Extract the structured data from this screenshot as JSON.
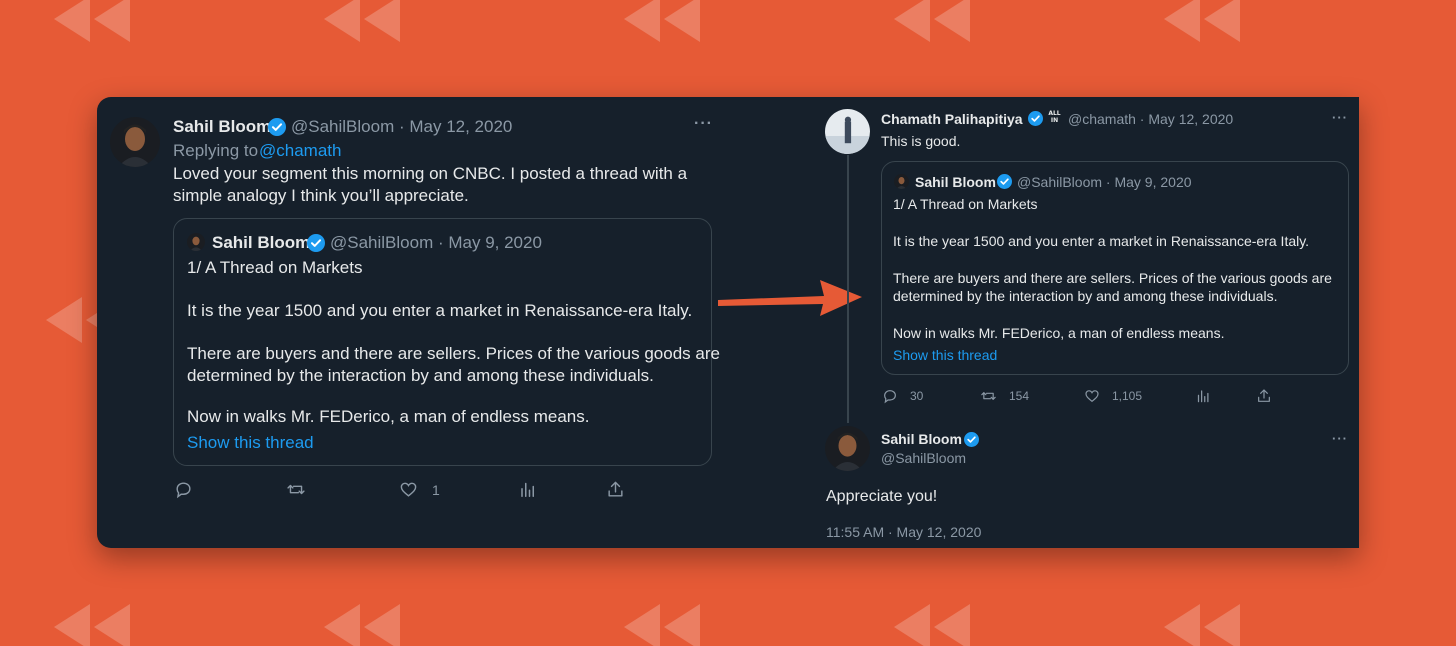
{
  "accent": "#1d9bf0",
  "background_color": "#e65a36",
  "left_tweet": {
    "author_name": "Sahil Bloom",
    "handle_date": "@SahilBloom · May 12, 2020",
    "replying_prefix": "Replying to",
    "replying_handle": "@chamath",
    "body_line1": "Loved your segment this morning on CNBC. I posted a thread with a",
    "body_line2": "simple analogy I think you’ll appreciate.",
    "more": "···",
    "quote": {
      "author_name": "Sahil Bloom",
      "handle_date": "@SahilBloom · May 9, 2020",
      "line1": "1/ A Thread on Markets",
      "line2": "It is the year 1500 and you enter a market in Renaissance-era Italy.",
      "line3": "There are buyers and there are sellers. Prices of the various goods are",
      "line4": "determined by the interaction by and among these individuals.",
      "line5": "Now in walks Mr. FEDerico, a man of endless means.",
      "show_thread": "Show this thread"
    },
    "actions": {
      "like_count": "1"
    }
  },
  "right_tweet": {
    "author_name": "Chamath Palihapitiya",
    "badge_label": "ALL IN",
    "handle_date": "@chamath · May 12, 2020",
    "body": "This is good.",
    "more": "···",
    "quote": {
      "author_name": "Sahil Bloom",
      "handle_date": "@SahilBloom · May 9, 2020",
      "line1": "1/ A Thread on Markets",
      "line2": "It is the year 1500 and you enter a market in Renaissance-era Italy.",
      "line3": "There are buyers and there are sellers. Prices of the various goods are",
      "line4": "determined by the interaction by and among these individuals.",
      "line5": "Now in walks Mr. FEDerico, a man of endless means.",
      "show_thread": "Show this thread"
    },
    "actions": {
      "reply_count": "30",
      "retweet_count": "154",
      "like_count": "1,105"
    }
  },
  "reply_tweet": {
    "author_name": "Sahil Bloom",
    "handle": "@SahilBloom",
    "body": "Appreciate you!",
    "timestamp": "11:55 AM · May 12, 2020",
    "more": "···"
  }
}
